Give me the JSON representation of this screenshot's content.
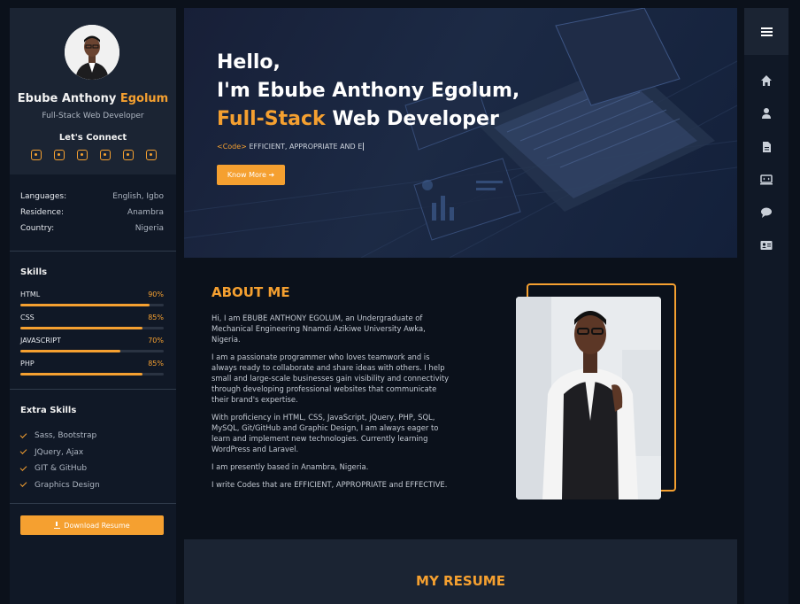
{
  "profile": {
    "first_name": "Ebube Anthony",
    "last_name": "Egolum",
    "role": "Full-Stack Web Developer",
    "connect_label": "Let's Connect",
    "social_icons": [
      "github-icon",
      "linkedin-icon",
      "facebook-icon",
      "instagram-icon",
      "twitter-icon",
      "gitlab-icon"
    ]
  },
  "info": [
    {
      "key": "Languages:",
      "value": "English, Igbo"
    },
    {
      "key": "Residence:",
      "value": "Anambra"
    },
    {
      "key": "Country:",
      "value": "Nigeria"
    }
  ],
  "skills": {
    "title": "Skills",
    "items": [
      {
        "label": "HTML",
        "percent": "90%",
        "level": 0.9
      },
      {
        "label": "CSS",
        "percent": "85%",
        "level": 0.85
      },
      {
        "label": "JAVASCRIPT",
        "percent": "70%",
        "level": 0.7
      },
      {
        "label": "PHP",
        "percent": "85%",
        "level": 0.85
      }
    ]
  },
  "extra_skills": {
    "title": "Extra Skills",
    "items": [
      "Sass, Bootstrap",
      "JQuery, Ajax",
      "GIT & GitHub",
      "Graphics Design"
    ]
  },
  "download_label": "Download Resume",
  "hero": {
    "line1": "Hello,",
    "line2": "I'm Ebube Anthony Egolum,",
    "line3_accent": "Full-Stack",
    "line3_rest": "Web Developer",
    "code_tag": "<Code>",
    "code_text": "EFFICIENT, APPROPRIATE AND E",
    "button": "Know More ➔"
  },
  "about": {
    "title": "ABOUT ME",
    "paragraphs": [
      "Hi, I am EBUBE ANTHONY EGOLUM, an Undergraduate of Mechanical Engineering Nnamdi Azikiwe University Awka, Nigeria.",
      "I am a passionate programmer who loves teamwork and is always ready to collaborate and share ideas with others. I help small and large-scale businesses gain visibility and connectivity through developing professional websites that communicate their brand's expertise.",
      "With proficiency in HTML, CSS, JavaScript, jQuery, PHP, SQL, MySQL, Git/GitHub and Graphic Design, I am always eager to learn and implement new technologies. Currently learning WordPress and Laravel.",
      "I am presently based in Anambra, Nigeria.",
      "I write Codes that are EFFICIENT, APPROPRIATE and EFFECTIVE."
    ]
  },
  "resume": {
    "title": "MY RESUME"
  },
  "nav_icons": [
    "home-icon",
    "user-icon",
    "document-icon",
    "portfolio-icon",
    "chat-icon",
    "contact-card-icon"
  ],
  "colors": {
    "accent": "#f5a030",
    "background": "#0b111b",
    "panel": "#1b2433"
  }
}
